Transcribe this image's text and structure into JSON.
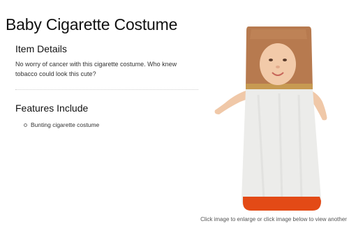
{
  "page": {
    "title": "Baby Cigarette Costume"
  },
  "item_details": {
    "heading": "Item Details",
    "description": "No worry of cancer with this cigarette costume. Who knew tobacco could look this cute?"
  },
  "features": {
    "heading": "Features Include",
    "items": [
      "Bunting cigarette costume"
    ]
  },
  "product_image": {
    "caption": "Click image to enlarge or click image below to view another"
  },
  "colors": {
    "filter_tan": "#b77a4f",
    "bunting_white": "#ececea",
    "tip_orange": "#e34a16"
  }
}
